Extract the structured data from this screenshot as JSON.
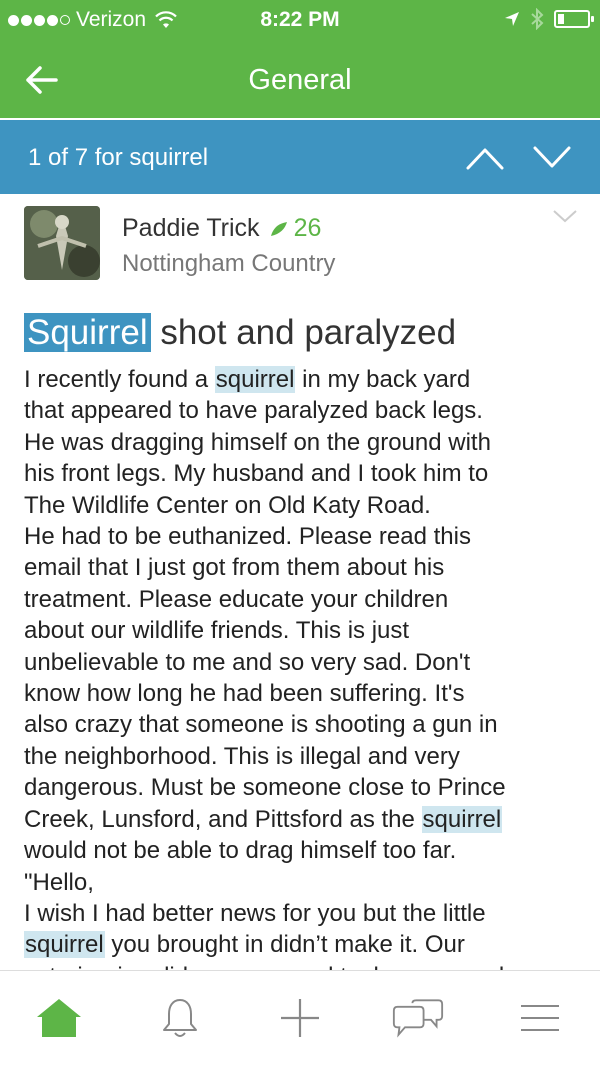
{
  "status_bar": {
    "carrier": "Verizon",
    "time": "8:22 PM",
    "signal_bars": 4,
    "signal_max": 5
  },
  "nav": {
    "title": "General",
    "back_icon": "arrow-left-icon"
  },
  "search": {
    "label_prefix": "1 of 7 for ",
    "query": "squirrel",
    "up_icon": "chevron-up-icon",
    "down_icon": "chevron-down-icon"
  },
  "post": {
    "author": "Paddie Trick",
    "points": "26",
    "location": "Nottingham Country",
    "title_highlight": "Squirrel",
    "title_rest": " shot and paralyzed",
    "lines": [
      [
        {
          "t": "I recently found a "
        },
        {
          "t": "squirrel",
          "h": true
        },
        {
          "t": " in my back yard"
        }
      ],
      [
        {
          "t": "that appeared to have paralyzed back legs."
        }
      ],
      [
        {
          "t": "He was dragging himself on the ground with"
        }
      ],
      [
        {
          "t": "his front legs. My husband and I took him to"
        }
      ],
      [
        {
          "t": "The Wildlife Center on Old Katy Road."
        }
      ],
      [
        {
          "t": "He had to be euthanized. Please read this"
        }
      ],
      [
        {
          "t": "email that I just got from them about his"
        }
      ],
      [
        {
          "t": "treatment. Please educate your children"
        }
      ],
      [
        {
          "t": "about our wildlife friends. This is just"
        }
      ],
      [
        {
          "t": "unbelievable to me and so very sad. Don't"
        }
      ],
      [
        {
          "t": "know how long he had been suffering. It's"
        }
      ],
      [
        {
          "t": "also crazy that someone is shooting a gun in"
        }
      ],
      [
        {
          "t": "the neighborhood. This is illegal and very"
        }
      ],
      [
        {
          "t": "dangerous. Must be someone close to Prince"
        }
      ],
      [
        {
          "t": "Creek, Lunsford, and Pittsford as the "
        },
        {
          "t": "squirrel",
          "h": true
        }
      ],
      [
        {
          "t": "would not be able to drag himself too far."
        }
      ],
      [
        {
          "t": "\"Hello,"
        }
      ],
      [
        {
          "t": "I wish I had better news for you but the little"
        }
      ],
      [
        {
          "t": "squirrel",
          "h": true
        },
        {
          "t": " you brought in didn’t make it. Our"
        }
      ],
      [
        {
          "t": "veterinarian did an exam and took x-rays and"
        }
      ]
    ]
  },
  "tabbar": {
    "items": [
      "home-icon",
      "bell-icon",
      "plus-icon",
      "chat-icon",
      "menu-icon"
    ],
    "active": "home-icon",
    "active_color": "#5db547"
  },
  "colors": {
    "header_green": "#5db547",
    "search_blue": "#3e94c1",
    "highlight": "#cfe6ef"
  }
}
